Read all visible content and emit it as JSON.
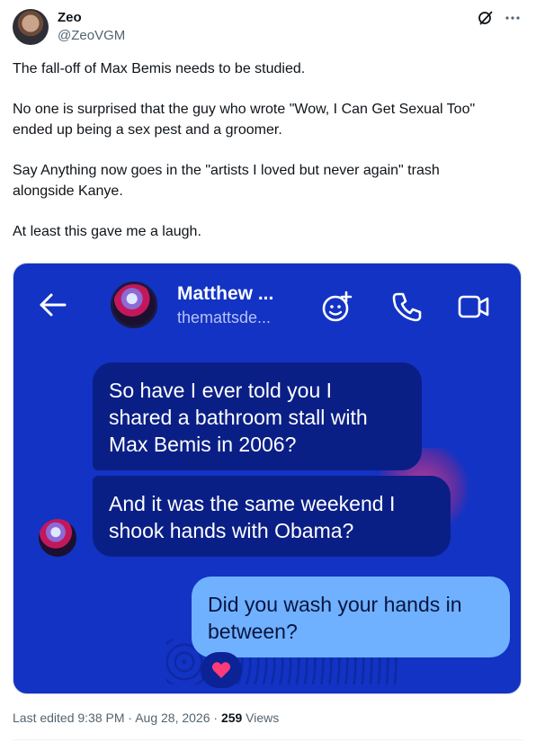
{
  "author": {
    "name": "Zeo",
    "handle": "@ZeoVGM"
  },
  "tweet": {
    "paragraphs": [
      "The fall-off of Max Bemis needs to be studied.",
      "No one is surprised that the guy who wrote \"Wow, I Can Get Sexual Too\"\nended up being a sex pest and a groomer.",
      "Say Anything now goes in the \"artists I loved but never again\" trash\nalongside Kanye.",
      "At least this gave me a laugh."
    ]
  },
  "media": {
    "chat": {
      "contact_name": "Matthew ...",
      "contact_handle": "themattsde...",
      "messages": [
        {
          "text": "So have I ever told you I\nshared a bathroom stall with\nMax Bemis in 2006?",
          "side": "received"
        },
        {
          "text": "And it was the same weekend I\nshook hands with Obama?",
          "side": "received"
        },
        {
          "text": "Did you wash your hands in\nbetween?",
          "side": "sent"
        }
      ],
      "reaction": "heart"
    }
  },
  "footer": {
    "edited": "Last edited 9:38 PM · Aug 28, 2026 · ",
    "views_count": "259",
    "views_label": " Views"
  },
  "icons": {
    "grok": "grok-icon",
    "more": "more-icon",
    "back": "back-arrow-icon",
    "emoji_add": "emoji-add-icon",
    "phone": "phone-icon",
    "video": "video-icon",
    "heart": "heart-icon"
  },
  "colors": {
    "chat_background": "#1233c4",
    "received_bubble": "#0a1f86",
    "sent_bubble": "#6fb1ff",
    "heart": "#ff3b78"
  }
}
